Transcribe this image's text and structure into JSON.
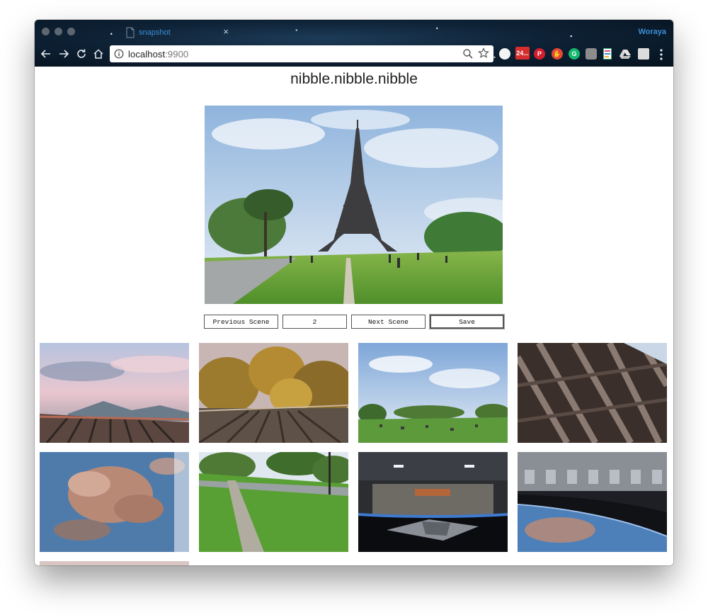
{
  "browser": {
    "tab_title": "snapshot",
    "tab_close": "×",
    "profile_name": "Woraya",
    "url_host": "localhost",
    "url_port": ":9900",
    "extension_badge": "24..."
  },
  "page": {
    "heading": "nibble.nibble.nibble",
    "hero_scene": "eiffel-tower",
    "controls": {
      "previous_label": "Previous Scene",
      "scene_value": "2",
      "next_label": "Next Scene",
      "save_label": "Save"
    },
    "thumbnails": [
      {
        "scene": "mountain-bridge-sunset"
      },
      {
        "scene": "autumn-bridge"
      },
      {
        "scene": "park-lawn"
      },
      {
        "scene": "wooden-planks"
      },
      {
        "scene": "earth-from-space"
      },
      {
        "scene": "grass-path"
      },
      {
        "scene": "spaceship-hangar"
      },
      {
        "scene": "space-station-earth"
      }
    ]
  },
  "colors": {
    "accent": "#3b8fd8",
    "chrome_dark": "#0e2236",
    "traffic_light": "#5d6770"
  }
}
